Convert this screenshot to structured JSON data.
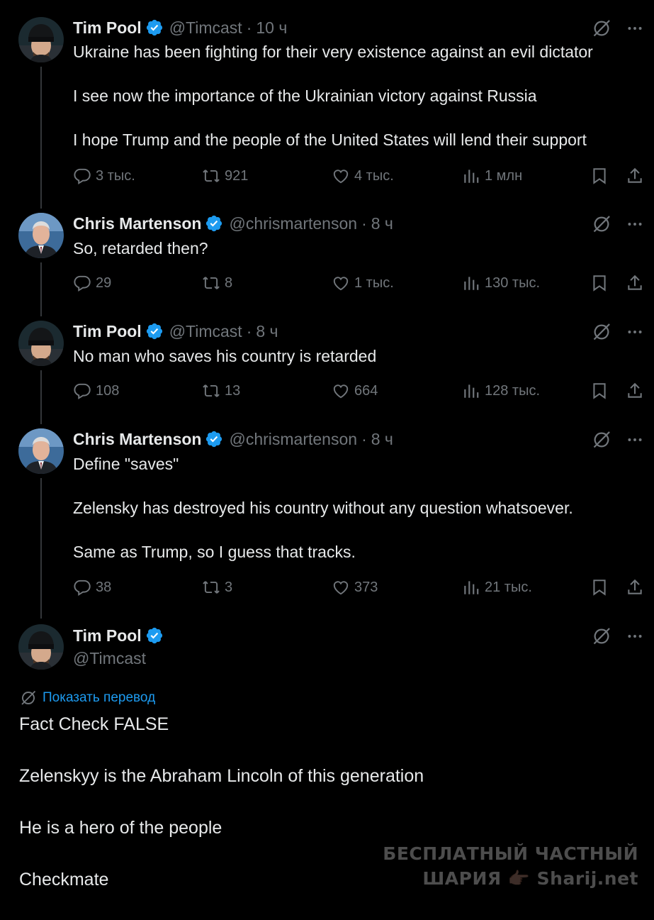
{
  "tweets": [
    {
      "name": "Tim Pool",
      "handle": "@Timcast",
      "separator": "·",
      "time": "10 ч",
      "paragraphs": [
        "Ukraine has been fighting for their very existence against an evil dictator",
        "I see now the importance of the Ukrainian victory against Russia",
        "I hope Trump and the people of the United States will lend their support"
      ],
      "replies": "3 тыс.",
      "reposts": "921",
      "likes": "4 тыс.",
      "views": "1 млн"
    },
    {
      "name": "Chris Martenson",
      "handle": "@chrismartenson",
      "separator": "·",
      "time": "8 ч",
      "paragraphs": [
        "So, retarded then?"
      ],
      "replies": "29",
      "reposts": "8",
      "likes": "1 тыс.",
      "views": "130 тыс."
    },
    {
      "name": "Tim Pool",
      "handle": "@Timcast",
      "separator": "·",
      "time": "8 ч",
      "paragraphs": [
        "No man who saves his country is retarded"
      ],
      "replies": "108",
      "reposts": "13",
      "likes": "664",
      "views": "128 тыс."
    },
    {
      "name": "Chris Martenson",
      "handle": "@chrismartenson",
      "separator": "·",
      "time": "8 ч",
      "paragraphs": [
        "Define \"saves\"",
        "Zelensky has destroyed his country without any question whatsoever.",
        "Same as Trump, so I guess that tracks."
      ],
      "replies": "38",
      "reposts": "3",
      "likes": "373",
      "views": "21 тыс."
    }
  ],
  "main_tweet": {
    "name": "Tim Pool",
    "handle": "@Timcast",
    "translate_label": "Показать перевод",
    "paragraphs": [
      "Fact Check FALSE",
      "Zelenskyy is the Abraham Lincoln of this generation",
      "He is a hero of the people",
      "Checkmate"
    ]
  },
  "watermark": {
    "line1": "БЕСПЛАТНЫЙ ЧАСТНЫЙ",
    "line2": "ШАРИЯ 👉🏿 Sharij.net"
  },
  "colors": {
    "background": "#000000",
    "text": "#e7e9ea",
    "secondary": "#71767b",
    "accent": "#1d9bf0"
  }
}
